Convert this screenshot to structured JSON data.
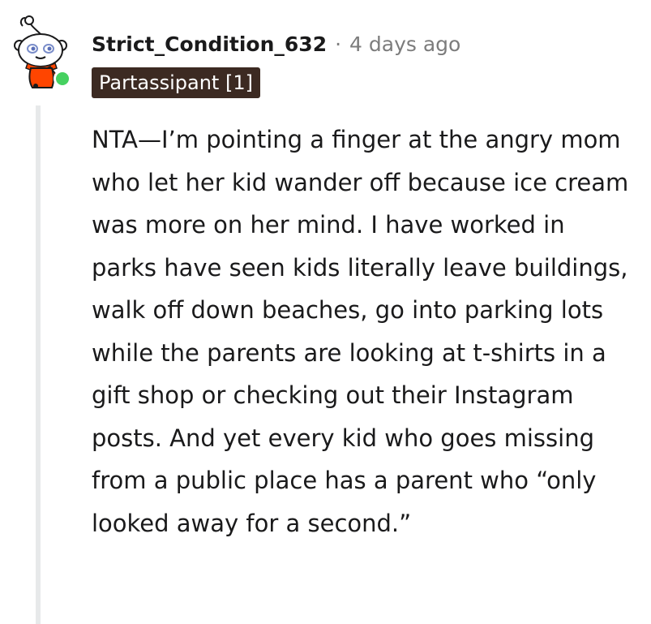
{
  "comment": {
    "username": "Strict_Condition_632",
    "separator": "·",
    "timestamp": "4 days ago",
    "flair": "Partassipant [1]",
    "body": "NTA—I’m pointing a finger at the angry mom who let her kid wander off because ice cream was more on her mind. I have worked in parks have seen kids literally leave buildings, walk off down beaches, go into parking lots while the parents are looking at t-shirts in a gift shop or checking out their Instagram posts. And yet every kid who goes missing from a public place has a parent who “only looked away for a second.”",
    "avatar_icon": "snoo-avatar-icon",
    "online_status": "online",
    "colors": {
      "flair_bg": "#3c2a22",
      "flair_text": "#ffffff",
      "online": "#46d160",
      "meta_text": "#7c7c7c",
      "thread_line": "#e7e9ea"
    }
  }
}
